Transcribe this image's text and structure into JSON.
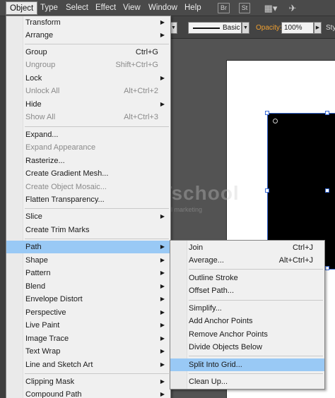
{
  "menubar": {
    "items": [
      "Object",
      "Type",
      "Select",
      "Effect",
      "View",
      "Window",
      "Help"
    ],
    "icons": [
      "Br",
      "St"
    ]
  },
  "control": {
    "stroke_style": "Basic",
    "opacity_label": "Opacity:",
    "opacity_value": "100%",
    "style_label": "Sty"
  },
  "watermark": {
    "text": "DUMETschool",
    "sub": "kursus website & digital marketing"
  },
  "object_menu": {
    "items": [
      {
        "label": "Transform",
        "shortcut": "",
        "submenu": true,
        "disabled": false
      },
      {
        "label": "Arrange",
        "shortcut": "",
        "submenu": true,
        "disabled": false
      },
      {
        "label": "Group",
        "shortcut": "Ctrl+G",
        "submenu": false,
        "disabled": false
      },
      {
        "label": "Ungroup",
        "shortcut": "Shift+Ctrl+G",
        "submenu": false,
        "disabled": true
      },
      {
        "label": "Lock",
        "shortcut": "",
        "submenu": true,
        "disabled": false
      },
      {
        "label": "Unlock All",
        "shortcut": "Alt+Ctrl+2",
        "submenu": false,
        "disabled": true
      },
      {
        "label": "Hide",
        "shortcut": "",
        "submenu": true,
        "disabled": false
      },
      {
        "label": "Show All",
        "shortcut": "Alt+Ctrl+3",
        "submenu": false,
        "disabled": true
      },
      {
        "label": "Expand...",
        "shortcut": "",
        "submenu": false,
        "disabled": false
      },
      {
        "label": "Expand Appearance",
        "shortcut": "",
        "submenu": false,
        "disabled": true
      },
      {
        "label": "Rasterize...",
        "shortcut": "",
        "submenu": false,
        "disabled": false
      },
      {
        "label": "Create Gradient Mesh...",
        "shortcut": "",
        "submenu": false,
        "disabled": false
      },
      {
        "label": "Create Object Mosaic...",
        "shortcut": "",
        "submenu": false,
        "disabled": true
      },
      {
        "label": "Flatten Transparency...",
        "shortcut": "",
        "submenu": false,
        "disabled": false
      },
      {
        "label": "Slice",
        "shortcut": "",
        "submenu": true,
        "disabled": false
      },
      {
        "label": "Create Trim Marks",
        "shortcut": "",
        "submenu": false,
        "disabled": false
      },
      {
        "label": "Path",
        "shortcut": "",
        "submenu": true,
        "disabled": false,
        "highlighted": true
      },
      {
        "label": "Shape",
        "shortcut": "",
        "submenu": true,
        "disabled": false
      },
      {
        "label": "Pattern",
        "shortcut": "",
        "submenu": true,
        "disabled": false
      },
      {
        "label": "Blend",
        "shortcut": "",
        "submenu": true,
        "disabled": false
      },
      {
        "label": "Envelope Distort",
        "shortcut": "",
        "submenu": true,
        "disabled": false
      },
      {
        "label": "Perspective",
        "shortcut": "",
        "submenu": true,
        "disabled": false
      },
      {
        "label": "Live Paint",
        "shortcut": "",
        "submenu": true,
        "disabled": false
      },
      {
        "label": "Image Trace",
        "shortcut": "",
        "submenu": true,
        "disabled": false
      },
      {
        "label": "Text Wrap",
        "shortcut": "",
        "submenu": true,
        "disabled": false
      },
      {
        "label": "Line and Sketch Art",
        "shortcut": "",
        "submenu": true,
        "disabled": false
      },
      {
        "label": "Clipping Mask",
        "shortcut": "",
        "submenu": true,
        "disabled": false
      },
      {
        "label": "Compound Path",
        "shortcut": "",
        "submenu": true,
        "disabled": false
      }
    ]
  },
  "path_submenu": {
    "items": [
      {
        "label": "Join",
        "shortcut": "Ctrl+J"
      },
      {
        "label": "Average...",
        "shortcut": "Alt+Ctrl+J"
      },
      {
        "label": "Outline Stroke",
        "shortcut": ""
      },
      {
        "label": "Offset Path...",
        "shortcut": ""
      },
      {
        "label": "Simplify...",
        "shortcut": ""
      },
      {
        "label": "Add Anchor Points",
        "shortcut": ""
      },
      {
        "label": "Remove Anchor Points",
        "shortcut": ""
      },
      {
        "label": "Divide Objects Below",
        "shortcut": ""
      },
      {
        "label": "Split Into Grid...",
        "shortcut": "",
        "highlighted": true
      },
      {
        "label": "Clean Up...",
        "shortcut": ""
      }
    ]
  }
}
